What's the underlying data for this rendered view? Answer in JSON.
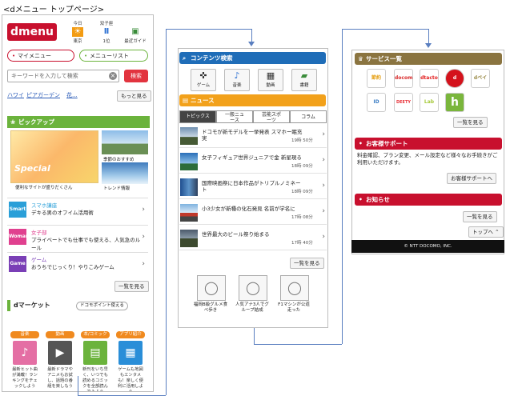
{
  "page": {
    "caption": "<dメニュー トップページ>"
  },
  "col1": {
    "logo": "dmenu",
    "top_icons": [
      {
        "label1": "今日",
        "label2": "東京",
        "icon": "sun-icon",
        "glyph": "☀"
      },
      {
        "label1": "双子座",
        "label2": "1位",
        "icon": "gemini-icon",
        "glyph": "Ⅱ"
      },
      {
        "label1": "最近ガイド",
        "label2": "",
        "icon": "guide-icon",
        "glyph": "▣"
      }
    ],
    "my_menu": "マイメニュー",
    "menu_list": "メニューリスト",
    "search": {
      "placeholder": "キーワードを入力して検索",
      "clear": "×",
      "button": "検索"
    },
    "keywords": [
      "ハワイ",
      "ピアガーデン",
      "花..."
    ],
    "keywords_more": "もっと見る",
    "pickup": {
      "title": "ピックアップ",
      "banner_text": "Special",
      "banner_caption": "便利なサイトが盛りだくさん",
      "thumb1_caption": "季節のおすすめ",
      "thumb2_caption": "トレンド情報",
      "rows": [
        {
          "tag": "Smart",
          "line1": "スマホ講座",
          "line2": "デキる男のオフイム活用術",
          "color": "#2a9fd8"
        },
        {
          "tag": "Woman",
          "line1": "女子部",
          "line2": "プライベートでも仕事でも使える、人気急のルール",
          "color": "#e0408f"
        },
        {
          "tag": "Game",
          "line1": "ゲーム",
          "line2": "おうちでじっくり！やりこみゲーム",
          "color": "#7a3fb6"
        }
      ],
      "more": "一覧を見る"
    },
    "dmarket": {
      "title": "dマーケット",
      "badge": "ドコモポイント使える",
      "tiles": [
        {
          "cat": "音楽",
          "caption": "最新ヒット曲が満載！ランキングをチェックしよう",
          "glyph": "♪",
          "color": "#e46fa4",
          "icon": "music-note-icon"
        },
        {
          "cat": "動画",
          "caption": "最新ドラマやアニメもお試し、話題の番組を楽しもう",
          "glyph": "▶",
          "color": "#555555",
          "icon": "video-clapper-icon"
        },
        {
          "cat": "本/コミック",
          "caption": "新刊をいち早く、いつでも読めるコミックを全部読んでみよう",
          "glyph": "▤",
          "color": "#6bb33c",
          "icon": "book-icon"
        },
        {
          "cat": "アプリ紹介",
          "caption": "ゲームも地図もエンタメも！楽しく便利に活用しよう",
          "glyph": "▦",
          "color": "#2a8ed8",
          "icon": "apps-icon"
        }
      ]
    }
  },
  "col2": {
    "search_header": "コンテンツ検索",
    "categories": [
      {
        "label": "ゲーム",
        "glyph": "✜",
        "icon": "gamepad-icon"
      },
      {
        "label": "音楽",
        "glyph": "♪",
        "icon": "music-note-icon"
      },
      {
        "label": "動画",
        "glyph": "▦",
        "icon": "film-icon"
      },
      {
        "label": "書籍",
        "glyph": "▰",
        "icon": "book-icon"
      }
    ],
    "news_header": "ニュース",
    "tabs": [
      "トピックス",
      "一般ニュース",
      "芸能スポーツ",
      "コラム"
    ],
    "news": [
      {
        "title": "ドコモが新モデルを一挙発表 スマホー眠充実",
        "time": "19時 50分"
      },
      {
        "title": "女子フィギュア世界ジュニアで金 新星現る",
        "time": "18時 09分"
      },
      {
        "title": "国際映画祭に日本作品がトリプルノミネート",
        "time": "18時 09分"
      },
      {
        "title": "小3少女が新種の化石発見 名前が学名に",
        "time": "17時 08分"
      },
      {
        "title": "世界最大のビール祭り始まる",
        "time": "17時 40分"
      }
    ],
    "more": "一覧を見る",
    "photos": [
      {
        "caption": "福岡B級グルメ食べ歩き"
      },
      {
        "caption": "人気アナ3人でグループ結成"
      },
      {
        "caption": "F1マシンが公道走った"
      }
    ]
  },
  "col3": {
    "service_header": "サービス一覧",
    "services": [
      {
        "label": "節約",
        "color": "#e6a117",
        "icon": "bookstore-icon"
      },
      {
        "label": "docomo",
        "color": "#d92b2b",
        "icon": "smart-life-icon"
      },
      {
        "label": "dtacto",
        "color": "#e21f1f",
        "icon": "doctor-icon"
      },
      {
        "label": "d",
        "color": "#d4121c",
        "icon": "auction-icon"
      },
      {
        "label": "dペイ",
        "color": "#9a8b48",
        "icon": "dpay-icon"
      },
      {
        "label": "ID",
        "color": "#3b7dc4",
        "icon": "id-icon"
      },
      {
        "label": "DEETY",
        "color": "#e8333a",
        "icon": "deety-icon"
      },
      {
        "label": "Lab",
        "color": "#a6c93a",
        "icon": "lab-icon"
      },
      {
        "label": "h",
        "color": "#7ab63c",
        "icon": "hikari-icon"
      }
    ],
    "service_more": "一覧を見る",
    "support_header": "お客様サポート",
    "support_text": "料金確認、プラン変更、メール設定など様々なお手続きがご利用いただけます。",
    "support_link": "お客様サポートへ",
    "notice_header": "お知らせ",
    "notice_more": "一覧を見る",
    "to_top": "トップへ",
    "footer": "© NTT DOCOMO, INC."
  }
}
